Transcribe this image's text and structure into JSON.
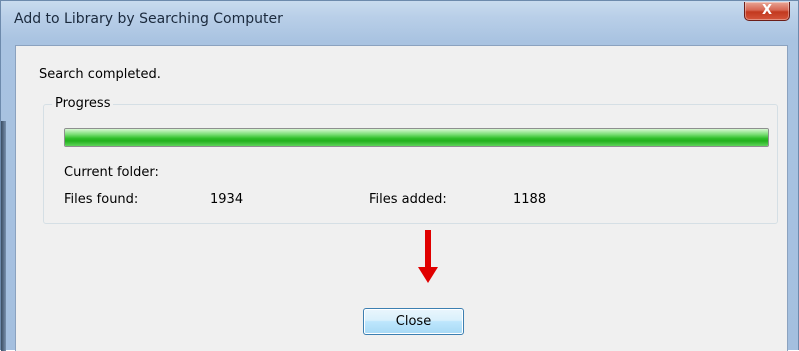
{
  "window": {
    "title": "Add to Library by Searching Computer",
    "close_glyph": "X"
  },
  "dialog": {
    "status": "Search completed.",
    "group_label": "Progress",
    "progress_fraction": 1.0,
    "current_folder_label": "Current folder:",
    "current_folder_value": "",
    "files_found_label": "Files found:",
    "files_found_value": "1934",
    "files_added_label": "Files added:",
    "files_added_value": "1188",
    "close_button_label": "Close"
  },
  "annotation": {
    "arrow_color": "#e00000",
    "arrow_icon": "arrow-down-icon"
  },
  "colors": {
    "progress_green": "#22b11d",
    "titlebar_blue": "#b9cfe8"
  }
}
